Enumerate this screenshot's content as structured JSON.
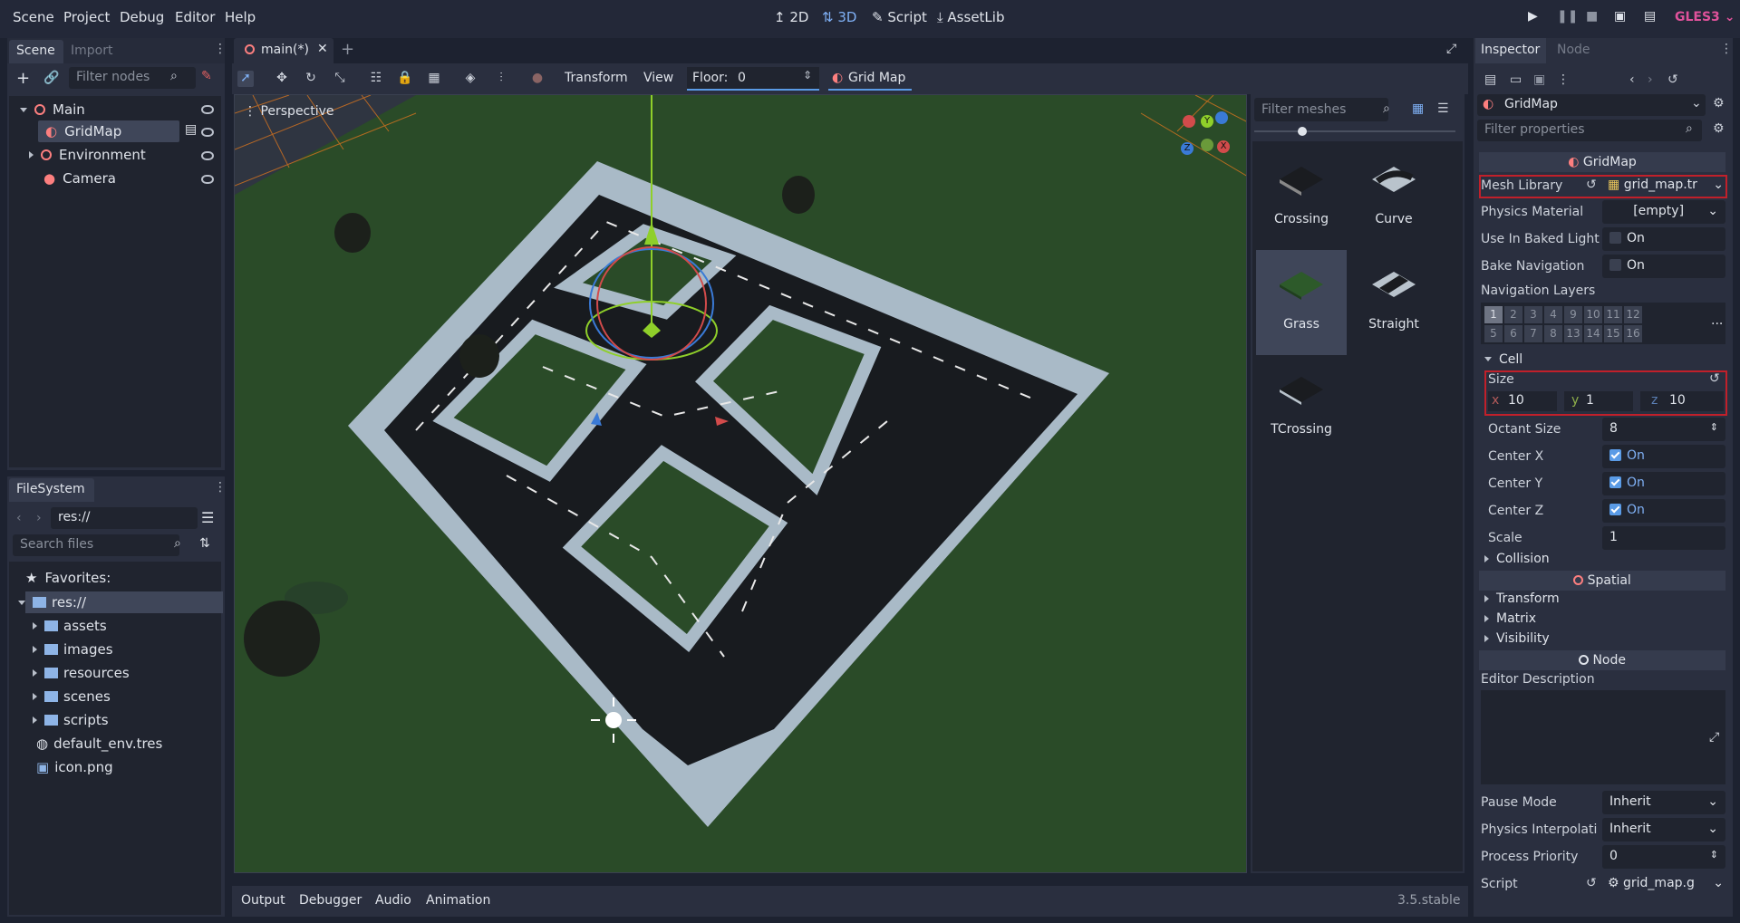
{
  "menu": [
    "Scene",
    "Project",
    "Debug",
    "Editor",
    "Help"
  ],
  "modes": {
    "m2d": "2D",
    "m3d": "3D",
    "script": "Script",
    "assetlib": "AssetLib"
  },
  "renderer": "GLES3",
  "scene_dock": {
    "tab_scene": "Scene",
    "tab_import": "Import",
    "filter_placeholder": "Filter nodes",
    "nodes": [
      {
        "label": "Main"
      },
      {
        "label": "GridMap"
      },
      {
        "label": "Environment"
      },
      {
        "label": "Camera"
      }
    ]
  },
  "filesystem": {
    "title": "FileSystem",
    "path": "res://",
    "search_placeholder": "Search files",
    "favorites": "Favorites:",
    "root": "res://",
    "folders": [
      "assets",
      "images",
      "resources",
      "scenes",
      "scripts"
    ],
    "files": [
      "default_env.tres",
      "icon.png"
    ]
  },
  "editor_tab": {
    "label": "main(*)"
  },
  "toolbar": {
    "transform": "Transform",
    "view": "View",
    "floor_label": "Floor:",
    "floor_value": "0",
    "gridmap": "Grid Map"
  },
  "viewport": {
    "perspective": "Perspective",
    "gizmo": {
      "x": "X",
      "y": "Y",
      "z": "Z"
    }
  },
  "mesh_palette": {
    "filter_placeholder": "Filter meshes",
    "items": [
      "Crossing",
      "Curve",
      "Grass",
      "Straight",
      "TCrossing"
    ],
    "selected": "Grass"
  },
  "bottom": {
    "tabs": [
      "Output",
      "Debugger",
      "Audio",
      "Animation"
    ],
    "version": "3.5.stable"
  },
  "inspector": {
    "tab_inspector": "Inspector",
    "tab_node": "Node",
    "object": "GridMap",
    "filter_placeholder": "Filter properties",
    "section_title": "GridMap",
    "mesh_library": {
      "label": "Mesh Library",
      "value": "grid_map.tr"
    },
    "physics_material": {
      "label": "Physics Material",
      "value": "[empty]"
    },
    "baked_light": {
      "label": "Use In Baked Light",
      "value": "On"
    },
    "bake_nav": {
      "label": "Bake Navigation",
      "value": "On"
    },
    "nav_layers": {
      "label": "Navigation Layers",
      "row1": [
        "1",
        "2",
        "3",
        "4",
        "9",
        "10",
        "11",
        "12"
      ],
      "row2": [
        "5",
        "6",
        "7",
        "8",
        "13",
        "14",
        "15",
        "16"
      ],
      "more": "..."
    },
    "cell": {
      "label": "Cell",
      "size_label": "Size",
      "x": "10",
      "y": "1",
      "z": "10",
      "ax": "x",
      "ay": "y",
      "az": "z",
      "octant_label": "Octant Size",
      "octant": "8",
      "cx_label": "Center X",
      "cy_label": "Center Y",
      "cz_label": "Center Z",
      "on": "On",
      "scale_label": "Scale",
      "scale": "1"
    },
    "collision": "Collision",
    "spatial": "Spatial",
    "transform": "Transform",
    "matrix": "Matrix",
    "visibility": "Visibility",
    "node_section": "Node",
    "editor_desc": "Editor Description",
    "pause_mode": {
      "label": "Pause Mode",
      "value": "Inherit"
    },
    "physics_interp": {
      "label": "Physics Interpolati",
      "value": "Inherit"
    },
    "process_priority": {
      "label": "Process Priority",
      "value": "0"
    },
    "script": {
      "label": "Script",
      "value": "grid_map.g"
    }
  }
}
